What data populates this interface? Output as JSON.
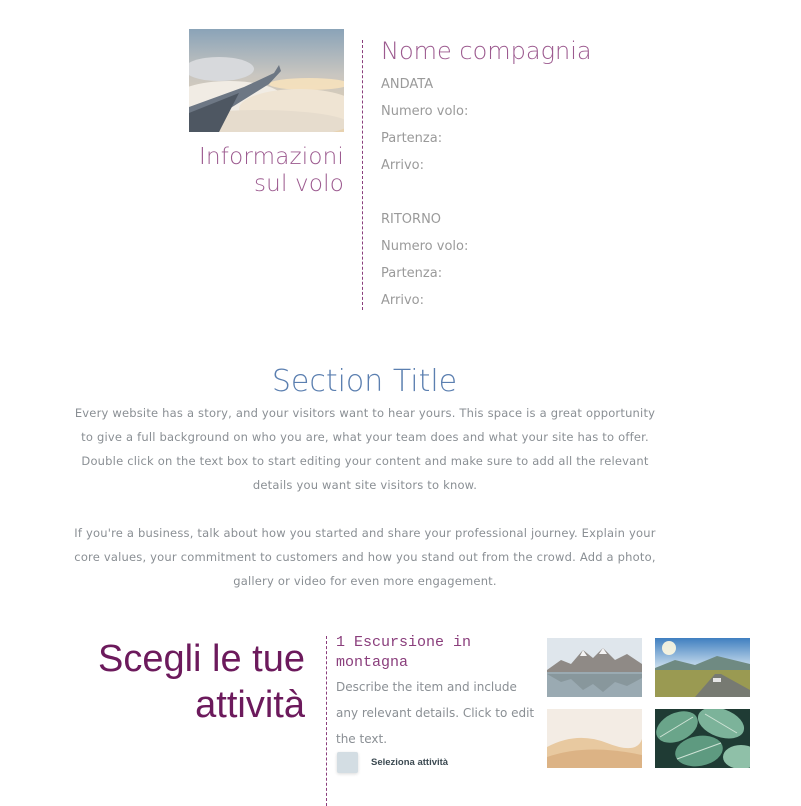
{
  "flight": {
    "section_title": "Informazioni sul volo",
    "company_name": "Nome compagnia",
    "outbound": {
      "heading": "ANDATA",
      "flight_number_label": "Numero volo:",
      "departure_label": "Partenza:",
      "arrival_label": "Arrivo:"
    },
    "return": {
      "heading": "RITORNO",
      "flight_number_label": "Numero volo:",
      "departure_label": "Partenza:",
      "arrival_label": "Arrivo:"
    }
  },
  "about": {
    "title": "Section Title",
    "paragraph1": "Every website has a story, and your visitors want to hear yours. This space is a great opportunity to give a full background on who you are, what your team does and what your site has to offer. Double click on the text box to start editing your content and make sure to add all the relevant details you want site visitors to know.",
    "paragraph2": "If you're a business, talk about how you started and share your professional journey. Explain your core values, your commitment to customers and how you stand out from the crowd. Add a photo, gallery or video for even more engagement."
  },
  "activities": {
    "title": "Scegli le tue attività",
    "item": {
      "name": "1 Escursione in montagna",
      "description": "Describe the item and include any relevant details. Click to edit the text.",
      "checkbox_label": "Seleziona attività"
    },
    "gallery": [
      "mountain-lake",
      "road-landscape",
      "desert-dunes",
      "tropical-leaves"
    ]
  },
  "colors": {
    "accent_purple": "#8a3e7c",
    "title_purple": "#6c1a5c",
    "section_blue": "#5b7fb0",
    "body_gray": "#8a8f94"
  }
}
